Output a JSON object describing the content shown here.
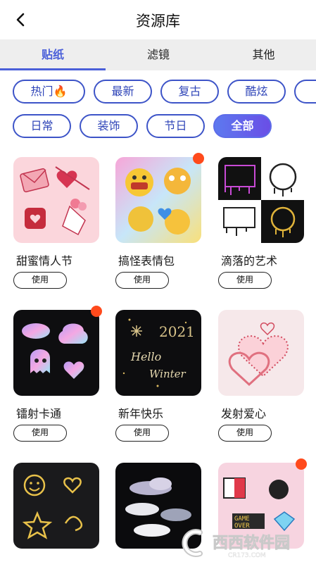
{
  "header": {
    "title": "资源库",
    "back_icon": "chevron-left-icon"
  },
  "tabs": [
    {
      "label": "贴纸",
      "active": true
    },
    {
      "label": "滤镜",
      "active": false
    },
    {
      "label": "其他",
      "active": false
    }
  ],
  "chips_row1": [
    {
      "label": "热门🔥",
      "active": false
    },
    {
      "label": "最新",
      "active": false
    },
    {
      "label": "复古",
      "active": false
    },
    {
      "label": "酷炫",
      "active": false
    },
    {
      "label": "",
      "active": false
    }
  ],
  "chips_row2": [
    {
      "label": "日常",
      "active": false
    },
    {
      "label": "装饰",
      "active": false
    },
    {
      "label": "节日",
      "active": false
    },
    {
      "label": "全部",
      "active": true
    }
  ],
  "colors": {
    "accent": "#4a5fd9",
    "badge": "#ff4a1c",
    "tab_bar_bg": "#eeeeee"
  },
  "cards": [
    {
      "name": "甜蜜情人节",
      "button": "使用",
      "badge": false
    },
    {
      "name": "搞怪表情包",
      "button": "使用",
      "badge": true
    },
    {
      "name": "滴落的艺术",
      "button": "使用",
      "badge": false
    },
    {
      "name": "镭射卡通",
      "button": "使用",
      "badge": true
    },
    {
      "name": "新年快乐",
      "button": "使用",
      "badge": false
    },
    {
      "name": "发射爱心",
      "button": "使用",
      "badge": false
    },
    {
      "name": "",
      "button": "",
      "badge": false
    },
    {
      "name": "",
      "button": "",
      "badge": false
    },
    {
      "name": "",
      "button": "",
      "badge": true
    }
  ],
  "thumb_texts": {
    "new_year": "2021",
    "hello": "Hello",
    "winter": "Winter",
    "game": "GAME",
    "over": "OVER"
  },
  "watermark": {
    "text": "西西软件园",
    "url": "CR173.COM"
  }
}
